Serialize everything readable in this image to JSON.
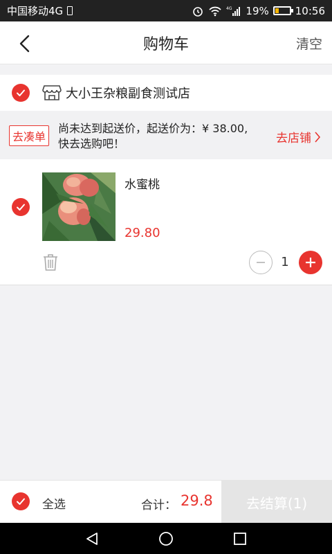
{
  "status_bar": {
    "carrier": "中国移动4G",
    "network": "4G",
    "battery_percent": "19%",
    "time": "10:56"
  },
  "header": {
    "title": "购物车",
    "clear_label": "清空"
  },
  "store": {
    "name": "大小王杂粮副食测试店",
    "selected": true
  },
  "notice": {
    "tag_label": "去凑单",
    "message": "尚未达到起送价，起送价为：¥ 38.00,快去选购吧！",
    "goto_label": "去店铺"
  },
  "cart_item": {
    "name": "水蜜桃",
    "price": "29.80",
    "quantity": "1",
    "selected": true
  },
  "footer": {
    "select_all_label": "全选",
    "total_label": "合计：",
    "total_value": "29.8",
    "checkout_label": "去结算(1)"
  },
  "colors": {
    "accent": "#e8342f",
    "background": "#f2f2f4",
    "checkout_disabled": "#e5e5e5"
  }
}
